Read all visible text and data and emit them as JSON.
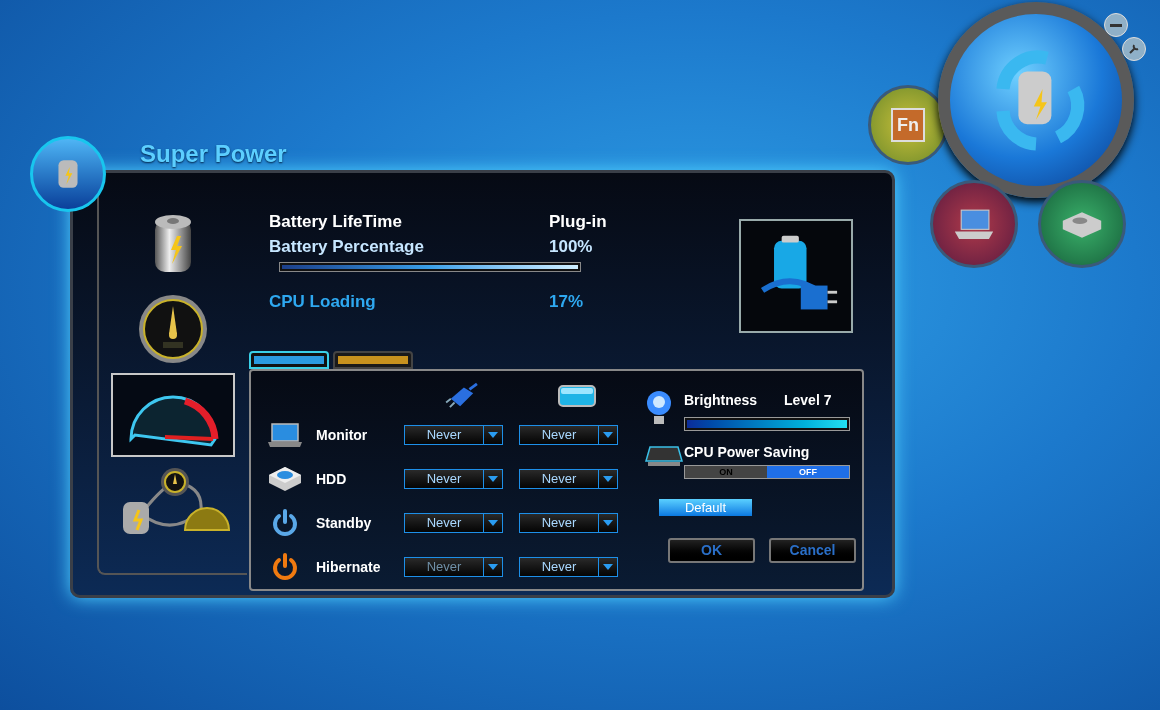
{
  "app": {
    "title": "Super Power"
  },
  "launcher": {
    "fn_label": "Fn"
  },
  "modes": [
    {
      "kind": "battery",
      "selected": false
    },
    {
      "kind": "gauge",
      "selected": false
    },
    {
      "kind": "speedometer",
      "selected": true
    },
    {
      "kind": "combined",
      "selected": false
    }
  ],
  "status": {
    "rows": [
      {
        "label": "Battery LifeTime",
        "value": "Plug-in",
        "highlight": false
      },
      {
        "label": "Battery Percentage",
        "value": "100%",
        "highlight": true
      }
    ],
    "percentage_bar": {
      "level": 1
    },
    "cpu": {
      "label": "CPU Loading",
      "value": "17%"
    }
  },
  "tabs": [
    {
      "kind": "blue",
      "selected": true
    },
    {
      "kind": "gold",
      "selected": false
    }
  ],
  "timers": {
    "columns": [
      {
        "kind": "plugged"
      },
      {
        "kind": "battery"
      }
    ],
    "rows": [
      {
        "kind": "monitor",
        "label": "Monitor",
        "settings": [
          {
            "value": "Never",
            "disabled": false
          },
          {
            "value": "Never",
            "disabled": false
          }
        ]
      },
      {
        "kind": "hdd",
        "label": "HDD",
        "settings": [
          {
            "value": "Never",
            "disabled": false
          },
          {
            "value": "Never",
            "disabled": false
          }
        ]
      },
      {
        "kind": "standby",
        "label": "Standby",
        "settings": [
          {
            "value": "Never",
            "disabled": false
          },
          {
            "value": "Never",
            "disabled": false
          }
        ]
      },
      {
        "kind": "hibernate",
        "label": "Hibernate",
        "settings": [
          {
            "value": "Never",
            "disabled": true
          },
          {
            "value": "Never",
            "disabled": false
          }
        ]
      }
    ]
  },
  "brightness": {
    "label": "Brightness",
    "reading": "Level 7",
    "level": 1
  },
  "cpu_power_saving": {
    "label": "CPU Power Saving",
    "options": [
      {
        "label": "ON",
        "selected": false
      },
      {
        "label": "OFF",
        "selected": true
      }
    ]
  },
  "buttons": {
    "default": "Default",
    "ok": "OK",
    "cancel": "Cancel"
  }
}
